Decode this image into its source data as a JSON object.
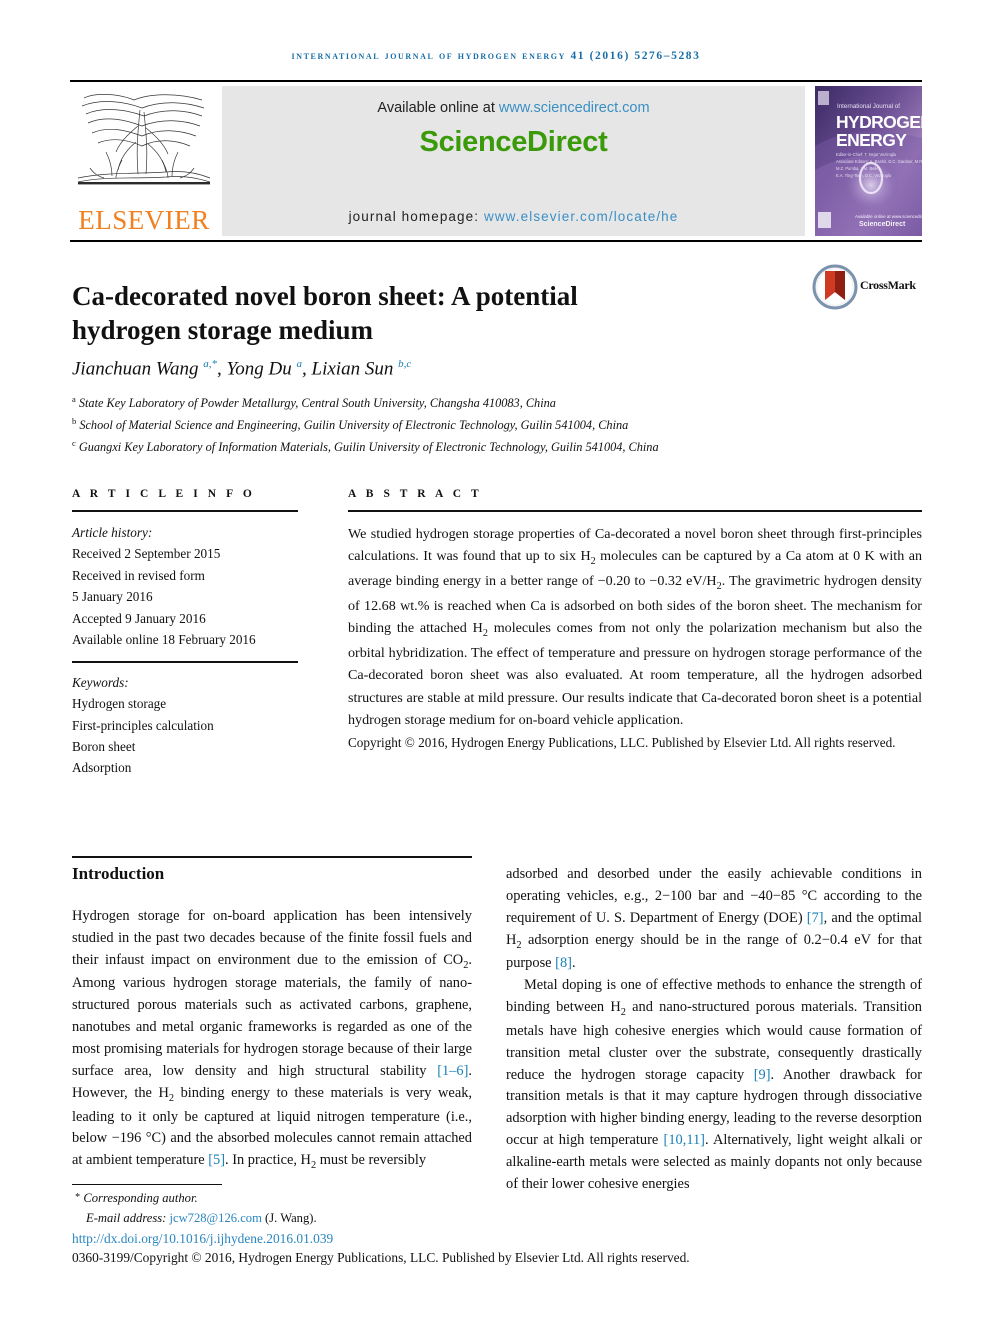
{
  "running_head": "International Journal of Hydrogen Energy 41 (2016) 5276–5283",
  "masthead": {
    "publisher_name": "ELSEVIER",
    "available_prefix": "Available online at ",
    "available_url": "www.sciencedirect.com",
    "sciencedirect_logo": "ScienceDirect",
    "homepage_prefix": "journal homepage: ",
    "homepage_url": "www.elsevier.com/locate/he",
    "cover": {
      "line1": "International Journal of",
      "line2": "HYDROGEN",
      "line3": "ENERGY",
      "editors_label": "Editor-in-Chief:",
      "editors": "T. Nejat Veziroglu",
      "assoc_label": "Associate Editors:",
      "assoc1": "A. Bashir, D.C. Gardner, M.R. Handa",
      "assoc2": "M.Z. Pumba, J.M. Belley",
      "assoc3": "E.A. Ting-Tsen, D.C. Veziroglu",
      "footer_brand": "ScienceDirect",
      "footer_pub": "Available online at www.sciencedirect.com"
    }
  },
  "article": {
    "title": "Ca-decorated novel boron sheet: A potential hydrogen storage medium",
    "crossmark_label": "CrossMark",
    "authors_html": "Jianchuan Wang <sup>a,*</sup>, Yong Du <sup>a</sup>, Lixian Sun <sup>b,c</sup>",
    "affiliations": [
      {
        "marker": "a",
        "text": "State Key Laboratory of Powder Metallurgy, Central South University, Changsha 410083, China"
      },
      {
        "marker": "b",
        "text": "School of Material Science and Engineering, Guilin University of Electronic Technology, Guilin 541004, China"
      },
      {
        "marker": "c",
        "text": "Guangxi Key Laboratory of Information Materials, Guilin University of Electronic Technology, Guilin 541004, China"
      }
    ]
  },
  "article_info": {
    "heading": "A R T I C L E   I N F O",
    "history_label": "Article history:",
    "history": [
      "Received 2 September 2015",
      "Received in revised form",
      "5 January 2016",
      "Accepted 9 January 2016",
      "Available online 18 February 2016"
    ],
    "keywords_label": "Keywords:",
    "keywords": [
      "Hydrogen storage",
      "First-principles calculation",
      "Boron sheet",
      "Adsorption"
    ]
  },
  "abstract": {
    "heading": "A B S T R A C T",
    "body_html": "We studied hydrogen storage properties of Ca-decorated a novel boron sheet through first-principles calculations. It was found that up to six H<sub>2</sub> molecules can be captured by a Ca atom at 0 K with an average binding energy in a better range of −0.20 to −0.32 eV/H<sub>2</sub>. The gravimetric hydrogen density of 12.68 wt.% is reached when Ca is adsorbed on both sides of the boron sheet. The mechanism for binding the attached H<sub>2</sub> molecules comes from not only the polarization mechanism but also the orbital hybridization. The effect of temperature and pressure on hydrogen storage performance of the Ca-decorated boron sheet was also evaluated. At room temperature, all the hydrogen adsorbed structures are stable at mild pressure. Our results indicate that Ca-decorated boron sheet is a potential hydrogen storage medium for on-board vehicle application.",
    "copyright": "Copyright © 2016, Hydrogen Energy Publications, LLC. Published by Elsevier Ltd. All rights reserved."
  },
  "introduction": {
    "heading": "Introduction",
    "left_para_html": "Hydrogen storage for on-board application has been intensively studied in the past two decades because of the finite fossil fuels and their infaust impact on environment due to the emission of CO<sub>2</sub>. Among various hydrogen storage materials, the family of nano-structured porous materials such as activated carbons, graphene, nanotubes and metal organic frameworks is regarded as one of the most promising materials for hydrogen storage because of their large surface area, low density and high structural stability <span class=\"ref\">[1–6]</span>. However, the H<sub>2</sub> binding energy to these materials is very weak, leading to it only be captured at liquid nitrogen temperature (i.e., below −196 °C) and the absorbed molecules cannot remain attached at ambient temperature <span class=\"ref\">[5]</span>. In practice, H<sub>2</sub> must be reversibly",
    "right_para1_html": "adsorbed and desorbed under the easily achievable conditions in operating vehicles, e.g., 2−100 bar and −40−85 °C according to the requirement of U. S. Department of Energy (DOE) <span class=\"ref\">[7]</span>, and the optimal H<sub>2</sub> adsorption energy should be in the range of 0.2−0.4 eV for that purpose <span class=\"ref\">[8]</span>.",
    "right_para2_html": "Metal doping is one of effective methods to enhance the strength of binding between H<sub>2</sub> and nano-structured porous materials. Transition metals have high cohesive energies which would cause formation of transition metal cluster over the substrate, consequently drastically reduce the hydrogen storage capacity <span class=\"ref\">[9]</span>. Another drawback for transition metals is that it may capture hydrogen through dissociative adsorption with higher binding energy, leading to the reverse desorption occur at high temperature <span class=\"ref\">[10,11]</span>. Alternatively, light weight alkali or alkaline-earth metals were selected as mainly dopants not only because of their lower cohesive energies"
  },
  "footer": {
    "corresponding_author": "Corresponding author.",
    "email_label": "E-mail address: ",
    "email": "jcw728@126.com",
    "email_suffix": " (J. Wang).",
    "doi": "http://dx.doi.org/10.1016/j.ijhydene.2016.01.039",
    "issn_line": "0360-3199/Copyright © 2016, Hydrogen Energy Publications, LLC. Published by Elsevier Ltd. All rights reserved."
  },
  "colors": {
    "link_blue": "#2a86c0",
    "running_head_blue": "#1a6ea8",
    "elsevier_orange": "#F08020",
    "sciencedirect_green": "#3a9a0a",
    "reference_blue": "#1a7fb5"
  }
}
